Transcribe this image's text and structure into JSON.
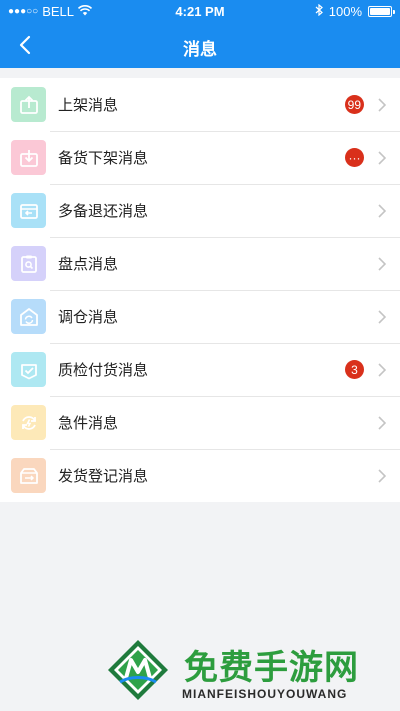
{
  "status_bar": {
    "signal": "●●●○○",
    "carrier": "BELL",
    "time": "4:21 PM",
    "battery_text": "100%"
  },
  "nav": {
    "title": "消息"
  },
  "items": [
    {
      "label": "上架消息",
      "icon": "upload-box-icon",
      "color": "#7fd3a4",
      "badge": "99"
    },
    {
      "label": "备货下架消息",
      "icon": "download-box-icon",
      "color": "#f59bb5",
      "badge": "···"
    },
    {
      "label": "多备退还消息",
      "icon": "return-box-icon",
      "color": "#5ec6ef",
      "badge": ""
    },
    {
      "label": "盘点消息",
      "icon": "inventory-search-icon",
      "color": "#a39bf3",
      "badge": ""
    },
    {
      "label": "调仓消息",
      "icon": "warehouse-transfer-icon",
      "color": "#6cbcf4",
      "badge": ""
    },
    {
      "label": "质检付货消息",
      "icon": "quality-check-icon",
      "color": "#5fd2e6",
      "badge": "3"
    },
    {
      "label": "急件消息",
      "icon": "urgent-refresh-icon",
      "color": "#f8d27a",
      "badge": ""
    },
    {
      "label": "发货登记消息",
      "icon": "shipment-register-icon",
      "color": "#f4b084",
      "badge": ""
    }
  ],
  "watermark": {
    "title": "免费手游网",
    "subtitle": "MIANFEISHOUYOUWANG"
  },
  "colors": {
    "primary": "#1a8cf0",
    "badge": "#d9301b",
    "background": "#f2f3f5"
  }
}
